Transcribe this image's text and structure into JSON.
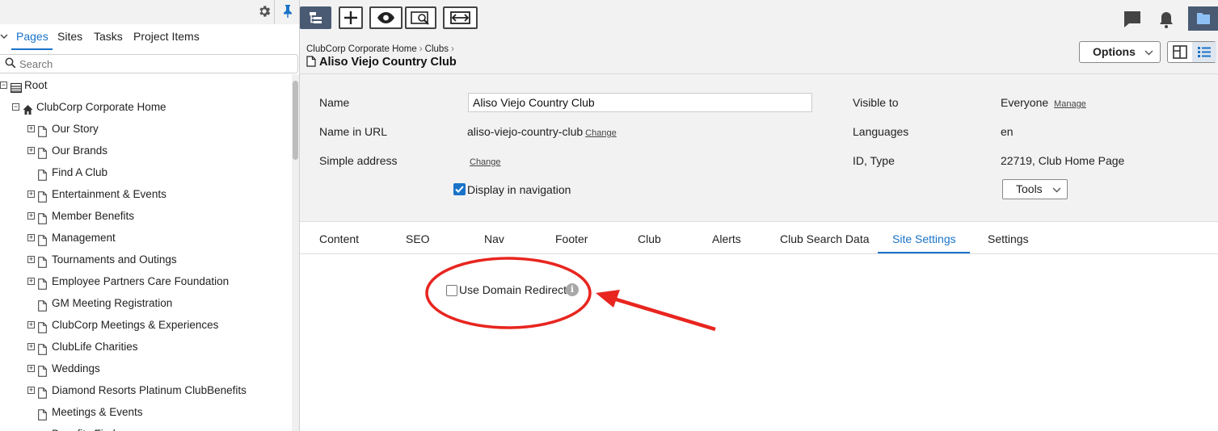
{
  "left_panel": {
    "tabs": [
      "Pages",
      "Sites",
      "Tasks",
      "Project Items"
    ],
    "search_placeholder": "Search",
    "tree": [
      {
        "label": "Root",
        "icon": "list-icon",
        "expander": "collapse"
      },
      {
        "label": "ClubCorp Corporate Home",
        "icon": "home-icon",
        "expander": "collapse"
      },
      {
        "label": "Our Story",
        "icon": "page-icon",
        "expander": "expand"
      },
      {
        "label": "Our Brands",
        "icon": "page-icon",
        "expander": "expand"
      },
      {
        "label": "Find A Club",
        "icon": "page-icon",
        "expander": "none"
      },
      {
        "label": "Entertainment & Events",
        "icon": "page-icon",
        "expander": "expand"
      },
      {
        "label": "Member Benefits",
        "icon": "page-icon",
        "expander": "expand"
      },
      {
        "label": "Management",
        "icon": "page-icon",
        "expander": "expand"
      },
      {
        "label": "Tournaments and Outings",
        "icon": "page-icon",
        "expander": "expand"
      },
      {
        "label": "Employee Partners Care Foundation",
        "icon": "page-icon",
        "expander": "expand"
      },
      {
        "label": "GM Meeting Registration",
        "icon": "page-icon",
        "expander": "none"
      },
      {
        "label": "ClubCorp Meetings & Experiences",
        "icon": "page-icon",
        "expander": "expand"
      },
      {
        "label": "ClubLife Charities",
        "icon": "page-icon",
        "expander": "expand"
      },
      {
        "label": "Weddings",
        "icon": "page-icon",
        "expander": "expand"
      },
      {
        "label": "Diamond Resorts Platinum ClubBenefits",
        "icon": "page-icon",
        "expander": "expand"
      },
      {
        "label": "Meetings & Events",
        "icon": "page-icon",
        "expander": "none"
      },
      {
        "label": "Benefits Finder",
        "icon": "page-icon",
        "expander": "none"
      }
    ]
  },
  "header": {
    "breadcrumbs": [
      "ClubCorp Corporate Home",
      "Clubs"
    ],
    "title": "Aliso Viejo Country Club",
    "options_label": "Options"
  },
  "properties": {
    "name_label": "Name",
    "name_value": "Aliso Viejo Country Club",
    "url_label": "Name in URL",
    "url_value": "aliso-viejo-country-club",
    "change_label": "Change",
    "simple_address_label": "Simple address",
    "display_nav_label": "Display in navigation",
    "display_nav_checked": true,
    "visible_to_label": "Visible to",
    "visible_to_value": "Everyone",
    "manage_label": "Manage",
    "languages_label": "Languages",
    "languages_value": "en",
    "id_type_label": "ID, Type",
    "id_type_value": "22719, Club Home Page",
    "tools_label": "Tools"
  },
  "tabs": [
    "Content",
    "SEO",
    "Nav",
    "Footer",
    "Club",
    "Alerts",
    "Club Search Data",
    "Site Settings",
    "Settings"
  ],
  "active_tab": "Site Settings",
  "site_settings": {
    "redirect_label": "Use Domain Redirect",
    "redirect_checked": false
  },
  "colors": {
    "accent": "#1a73c8",
    "toolbar_dark": "#4a5a73",
    "annotation_red": "#e8251f"
  }
}
